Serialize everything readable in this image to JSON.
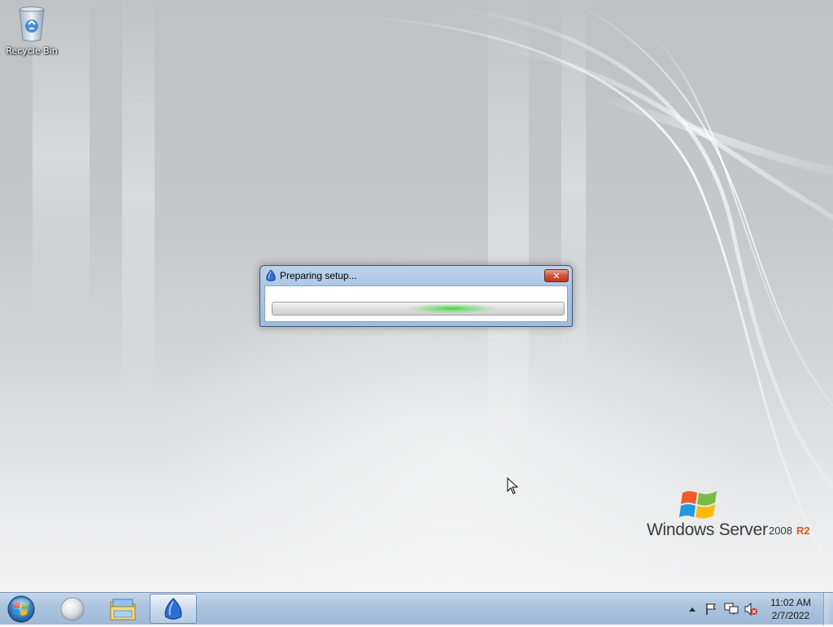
{
  "desktop": {
    "icons": [
      {
        "label": "Recycle Bin",
        "icon": "recycle-bin-icon"
      }
    ]
  },
  "dialog": {
    "title": "Preparing setup...",
    "icon": "setup-icon",
    "close_glyph": "✕",
    "progress_style": "marquee"
  },
  "brand": {
    "name": "Windows Server",
    "version": "2008",
    "edition": "R2",
    "colors": {
      "text": "#3a3a3a",
      "edition": "#e25a17"
    }
  },
  "taskbar": {
    "start_icon": "windows-orb-icon",
    "buttons": [
      {
        "icon": "internet-explorer-icon",
        "active": false
      },
      {
        "icon": "windows-explorer-icon",
        "active": false
      },
      {
        "icon": "setup-icon",
        "active": true
      }
    ],
    "tray": {
      "icons": [
        "show-hidden-icons-icon",
        "action-center-flag-icon",
        "network-icon",
        "volume-muted-icon"
      ],
      "time": "11:02 AM",
      "date": "2/7/2022"
    }
  }
}
